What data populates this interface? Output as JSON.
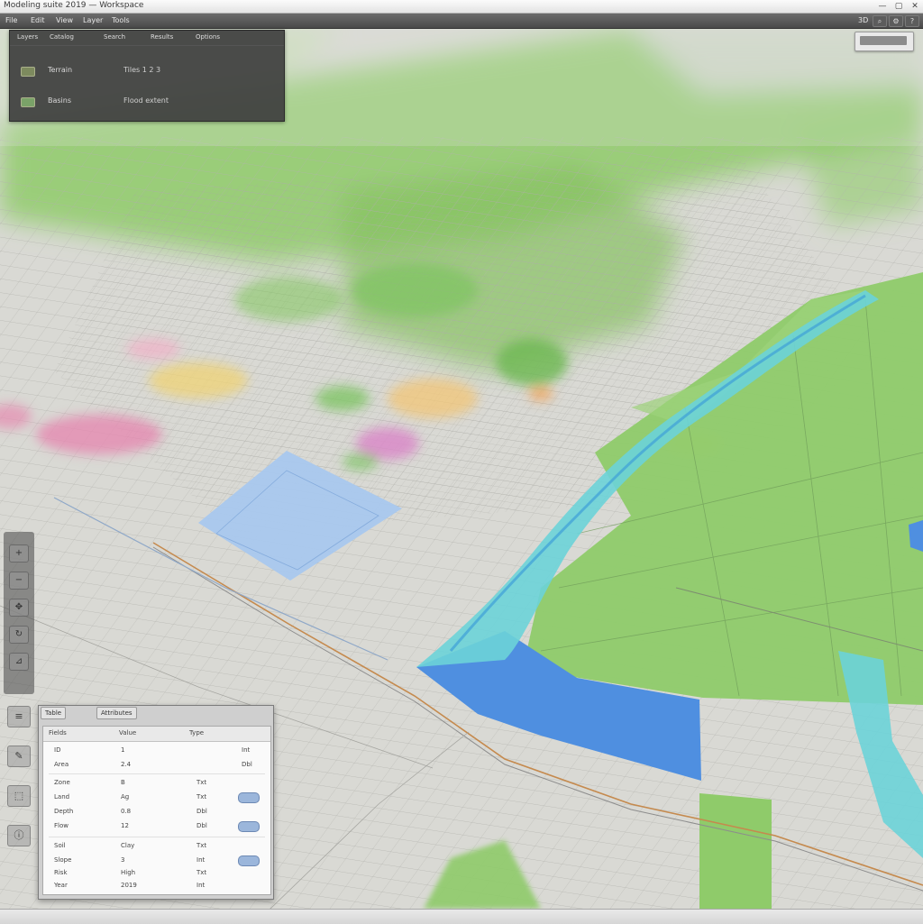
{
  "window": {
    "title": "Modeling suite 2019 — Workspace",
    "controls": [
      "—",
      "▢",
      "✕"
    ]
  },
  "toolbar": {
    "items": [
      "File",
      "Edit",
      "View",
      "Layer",
      "Tools"
    ],
    "right_label": "3D",
    "icons": [
      "search-icon",
      "settings-icon",
      "help-icon"
    ]
  },
  "layer_panel": {
    "tabs": [
      "Layers",
      "Catalog",
      "Search",
      "Results",
      "Options"
    ],
    "rows": [
      {
        "name": "Terrain",
        "value": "Tiles 1 2 3"
      },
      {
        "name": "Basins",
        "value": "Flood extent"
      }
    ]
  },
  "search": {
    "placeholder": ""
  },
  "attribute_table": {
    "tabs": [
      "Table",
      "Attributes"
    ],
    "columns": [
      "Fields",
      "Value",
      "Type"
    ],
    "rows": [
      {
        "field": "ID",
        "value": "1",
        "type": "Int"
      },
      {
        "field": "Area",
        "value": "2.4",
        "type": "Dbl"
      },
      {
        "field": "Zone",
        "value": "B",
        "type": "Txt"
      },
      {
        "field": "Land",
        "value": "Ag",
        "type": "Txt"
      },
      {
        "field": "Depth",
        "value": "0.8",
        "type": "Dbl"
      },
      {
        "field": "Flow",
        "value": "12",
        "type": "Dbl"
      },
      {
        "field": "Soil",
        "value": "Clay",
        "type": "Txt"
      },
      {
        "field": "Slope",
        "value": "3",
        "type": "Int"
      },
      {
        "field": "Risk",
        "value": "High",
        "type": "Txt"
      },
      {
        "field": "Year",
        "value": "2019",
        "type": "Int"
      }
    ]
  },
  "status": {
    "text": ""
  },
  "colors": {
    "water_blue": "#4f8fe0",
    "water_light": "#a7c6ee",
    "river_cyan": "#6cd3d8",
    "vegetation": "#8cc866",
    "ground": "#d8d8d3",
    "road": "#c58a4e"
  }
}
